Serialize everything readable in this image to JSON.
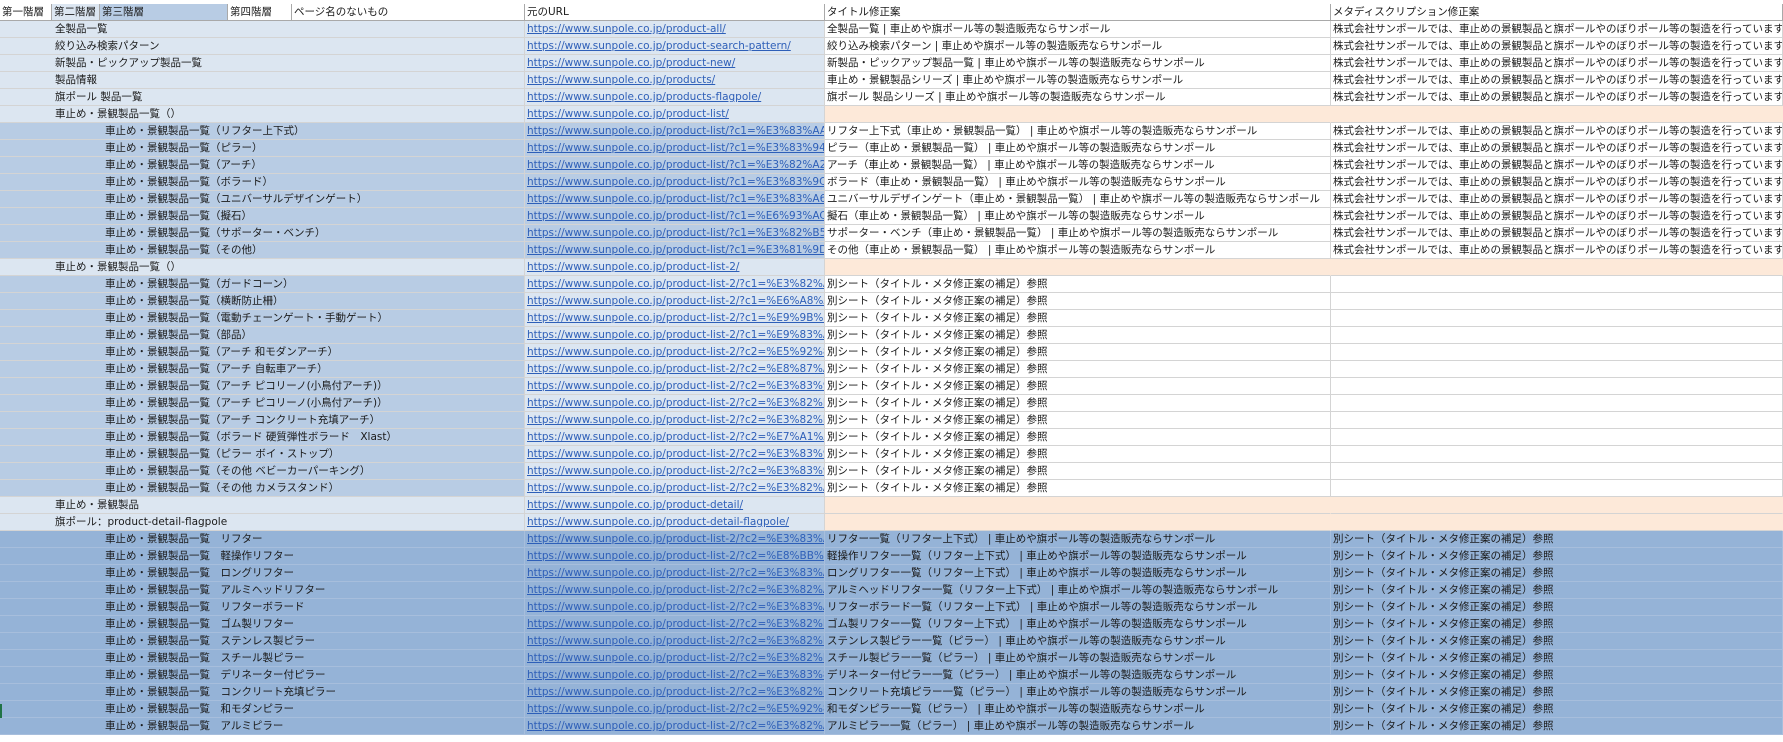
{
  "headers": [
    "第一階層",
    "第二階層",
    "第三階層",
    "第四階層",
    "ページ名のないもの",
    "元のURL",
    "タイトル修正案",
    "メタディスクリプション修正案"
  ],
  "rows": [
    {
      "style": "a",
      "level": 2,
      "name": "全製品一覧",
      "url": "https://www.sunpole.co.jp/product-all/",
      "title": "全製品一覧 | 車止めや旗ポール等の製造販売ならサンポール",
      "meta": "株式会社サンポールでは、車止めの景観製品と旗ポールやのぼりポール等の製造を行っています。"
    },
    {
      "style": "a",
      "level": 2,
      "name": "絞り込み検索パターン",
      "url": "https://www.sunpole.co.jp/product-search-pattern/",
      "title": "絞り込み検索パターン | 車止めや旗ポール等の製造販売ならサンポール",
      "meta": "株式会社サンポールでは、車止めの景観製品と旗ポールやのぼりポール等の製造を行っています。"
    },
    {
      "style": "a",
      "level": 2,
      "name": "新製品・ピックアップ製品一覧",
      "url": "https://www.sunpole.co.jp/product-new/",
      "title": "新製品・ピックアップ製品一覧 | 車止めや旗ポール等の製造販売ならサンポール",
      "meta": "株式会社サンポールでは、車止めの景観製品と旗ポールやのぼりポール等の製造を行っています。"
    },
    {
      "style": "a",
      "level": 2,
      "name": "製品情報",
      "url": "https://www.sunpole.co.jp/products/",
      "title": "車止め・景観製品シリーズ | 車止めや旗ポール等の製造販売ならサンポール",
      "meta": "株式会社サンポールでは、車止めの景観製品と旗ポールやのぼりポール等の製造を行っています。"
    },
    {
      "style": "a",
      "level": 2,
      "name": "旗ポール 製品一覧",
      "url": "https://www.sunpole.co.jp/products-flagpole/",
      "title": "旗ポール 製品シリーズ | 車止めや旗ポール等の製造販売ならサンポール",
      "meta": "株式会社サンポールでは、車止めの景観製品と旗ポールやのぼりポール等の製造を行っています。"
    },
    {
      "style": "b",
      "level": 2,
      "name": "車止め・景観製品一覧（）",
      "url": "https://www.sunpole.co.jp/product-list/",
      "title": "",
      "meta": ""
    },
    {
      "style": "c",
      "level": 3,
      "name": "車止め・景観製品一覧（リフター上下式）",
      "url": "https://www.sunpole.co.jp/product-list/?c1=%E3%83%AA%E3",
      "title": "リフター上下式（車止め・景観製品一覧） | 車止めや旗ポール等の製造販売ならサンポール",
      "meta": "株式会社サンポールでは、車止めの景観製品と旗ポールやのぼりポール等の製造を行っています。"
    },
    {
      "style": "c",
      "level": 3,
      "name": "車止め・景観製品一覧（ピラー）",
      "url": "https://www.sunpole.co.jp/product-list/?c1=%E3%83%94%E3",
      "title": "ピラー（車止め・景観製品一覧） | 車止めや旗ポール等の製造販売ならサンポール",
      "meta": "株式会社サンポールでは、車止めの景観製品と旗ポールやのぼりポール等の製造を行っています。"
    },
    {
      "style": "c",
      "level": 3,
      "name": "車止め・景観製品一覧（アーチ）",
      "url": "https://www.sunpole.co.jp/product-list/?c1=%E3%82%A2%E3",
      "title": "アーチ（車止め・景観製品一覧） | 車止めや旗ポール等の製造販売ならサンポール",
      "meta": "株式会社サンポールでは、車止めの景観製品と旗ポールやのぼりポール等の製造を行っています。"
    },
    {
      "style": "c",
      "level": 3,
      "name": "車止め・景観製品一覧（ボラード）",
      "url": "https://www.sunpole.co.jp/product-list/?c1=%E3%83%9C%E3",
      "title": "ボラード（車止め・景観製品一覧） | 車止めや旗ポール等の製造販売ならサンポール",
      "meta": "株式会社サンポールでは、車止めの景観製品と旗ポールやのぼりポール等の製造を行っています。"
    },
    {
      "style": "c",
      "level": 3,
      "name": "車止め・景観製品一覧（ユニバーサルデザインゲート）",
      "url": "https://www.sunpole.co.jp/product-list/?c1=%E3%83%A6%E3",
      "title": "ユニバーサルデザインゲート（車止め・景観製品一覧） | 車止めや旗ポール等の製造販売ならサンポール",
      "meta": "株式会社サンポールでは、車止めの景観製品と旗ポールやのぼりポール等の製造を行っています。"
    },
    {
      "style": "c",
      "level": 3,
      "name": "車止め・景観製品一覧（擬石）",
      "url": "https://www.sunpole.co.jp/product-list/?c1=%E6%93%AC%E7",
      "title": "擬石（車止め・景観製品一覧） | 車止めや旗ポール等の製造販売ならサンポール",
      "meta": "株式会社サンポールでは、車止めの景観製品と旗ポールやのぼりポール等の製造を行っています。"
    },
    {
      "style": "c",
      "level": 3,
      "name": "車止め・景観製品一覧（サポーター・ベンチ）",
      "url": "https://www.sunpole.co.jp/product-list/?c1=%E3%82%B5%E3",
      "title": "サポーター・ベンチ（車止め・景観製品一覧） | 車止めや旗ポール等の製造販売ならサンポール",
      "meta": "株式会社サンポールでは、車止めの景観製品と旗ポールやのぼりポール等の製造を行っています。"
    },
    {
      "style": "c",
      "level": 3,
      "name": "車止め・景観製品一覧（その他）",
      "url": "https://www.sunpole.co.jp/product-list/?c1=%E3%81%9D%E3",
      "title": "その他（車止め・景観製品一覧） | 車止めや旗ポール等の製造販売ならサンポール",
      "meta": "株式会社サンポールでは、車止めの景観製品と旗ポールやのぼりポール等の製造を行っています。"
    },
    {
      "style": "b",
      "level": 2,
      "name": "車止め・景観製品一覧（）",
      "url": "https://www.sunpole.co.jp/product-list-2/",
      "title": "",
      "meta": ""
    },
    {
      "style": "d",
      "level": 3,
      "name": "車止め・景観製品一覧（ガードコーン）",
      "url": "https://www.sunpole.co.jp/product-list-2/?c1=%E3%82%AC%",
      "title": "別シート（タイトル・メタ修正案の補足）参照",
      "meta": ""
    },
    {
      "style": "d",
      "level": 3,
      "name": "車止め・景観製品一覧（横断防止柵）",
      "url": "https://www.sunpole.co.jp/product-list-2/?c1=%E6%A8%AA%",
      "title": "別シート（タイトル・メタ修正案の補足）参照",
      "meta": ""
    },
    {
      "style": "d",
      "level": 3,
      "name": "車止め・景観製品一覧（電動チェーンゲート・手動ゲート）",
      "url": "https://www.sunpole.co.jp/product-list-2/?c1=%E9%9B%BB%",
      "title": "別シート（タイトル・メタ修正案の補足）参照",
      "meta": ""
    },
    {
      "style": "d",
      "level": 3,
      "name": "車止め・景観製品一覧（部品）",
      "url": "https://www.sunpole.co.jp/product-list-2/?c1=%E9%83%A8%",
      "title": "別シート（タイトル・メタ修正案の補足）参照",
      "meta": ""
    },
    {
      "style": "d",
      "level": 3,
      "name": "車止め・景観製品一覧（アーチ 和モダンアーチ）",
      "url": "https://www.sunpole.co.jp/product-list-2/?c2=%E5%92%8C%",
      "title": "別シート（タイトル・メタ修正案の補足）参照",
      "meta": ""
    },
    {
      "style": "d",
      "level": 3,
      "name": "車止め・景観製品一覧（アーチ 自転車アーチ）",
      "url": "https://www.sunpole.co.jp/product-list-2/?c2=%E8%87%AA%",
      "title": "別シート（タイトル・メタ修正案の補足）参照",
      "meta": ""
    },
    {
      "style": "d",
      "level": 3,
      "name": "車止め・景観製品一覧（アーチ ピコリーノ(小鳥付アーチ)）",
      "url": "https://www.sunpole.co.jp/product-list-2/?c2=%E3%83%94%",
      "title": "別シート（タイトル・メタ修正案の補足）参照",
      "meta": ""
    },
    {
      "style": "d",
      "level": 3,
      "name": "車止め・景観製品一覧（アーチ ピコリーノ(小鳥付アーチ)）",
      "url": "https://www.sunpole.co.jp/product-list-2/?c2=%E3%82%B3%",
      "title": "別シート（タイトル・メタ修正案の補足）参照",
      "meta": ""
    },
    {
      "style": "d",
      "level": 3,
      "name": "車止め・景観製品一覧（アーチ コンクリート充填アーチ）",
      "url": "https://www.sunpole.co.jp/product-list-2/?c2=%E3%82%B3%",
      "title": "別シート（タイトル・メタ修正案の補足）参照",
      "meta": ""
    },
    {
      "style": "d",
      "level": 3,
      "name": "車止め・景観製品一覧（ボラード 硬質弾性ボラード　Xlast）",
      "url": "https://www.sunpole.co.jp/product-list-2/?c2=%E7%A1%AC%",
      "title": "別シート（タイトル・メタ修正案の補足）参照",
      "meta": ""
    },
    {
      "style": "d",
      "level": 3,
      "name": "車止め・景観製品一覧（ピラー ボイ・ストップ）",
      "url": "https://www.sunpole.co.jp/product-list-2/?c2=%E3%83%9D%",
      "title": "別シート（タイトル・メタ修正案の補足）参照",
      "meta": ""
    },
    {
      "style": "d",
      "level": 3,
      "name": "車止め・景観製品一覧（その他 ベビーカーパーキング）",
      "url": "https://www.sunpole.co.jp/product-list-2/?c2=%E3%83%99%",
      "title": "別シート（タイトル・メタ修正案の補足）参照",
      "meta": ""
    },
    {
      "style": "d",
      "level": 3,
      "name": "車止め・景観製品一覧（その他 カメラスタンド）",
      "url": "https://www.sunpole.co.jp/product-list-2/?c2=%E3%82%AB%",
      "title": "別シート（タイトル・メタ修正案の補足）参照",
      "meta": ""
    },
    {
      "style": "b",
      "level": 2,
      "name": "車止め・景観製品",
      "url": "https://www.sunpole.co.jp/product-detail/",
      "title": "",
      "meta": ""
    },
    {
      "style": "b",
      "level": 2,
      "name": "旗ポール：product-detail-flagpole",
      "url": "https://www.sunpole.co.jp/product-detail-flagpole/",
      "title": "",
      "meta": ""
    },
    {
      "style": "e",
      "level": 3,
      "name": "車止め・景観製品一覧　リフター",
      "url": "https://www.sunpole.co.jp/product-list-2/?c2=%E3%83%AA%",
      "title": "リフター一覧（リフター上下式） | 車止めや旗ポール等の製造販売ならサンポール",
      "meta": "別シート（タイトル・メタ修正案の補足）参照"
    },
    {
      "style": "e",
      "level": 3,
      "name": "車止め・景観製品一覧　軽操作リフター",
      "url": "https://www.sunpole.co.jp/product-list-2/?c2=%E8%BB%BD%",
      "title": "軽操作リフター一覧（リフター上下式） | 車止めや旗ポール等の製造販売ならサンポール",
      "meta": "別シート（タイトル・メタ修正案の補足）参照"
    },
    {
      "style": "e",
      "level": 3,
      "name": "車止め・景観製品一覧　ロングリフター",
      "url": "https://www.sunpole.co.jp/product-list-2/?c2=%E3%83%AD%",
      "title": "ロングリフター一覧（リフター上下式） | 車止めや旗ポール等の製造販売ならサンポール",
      "meta": "別シート（タイトル・メタ修正案の補足）参照"
    },
    {
      "style": "e",
      "level": 3,
      "name": "車止め・景観製品一覧　アルミヘッドリフター",
      "url": "https://www.sunpole.co.jp/product-list-2/?c2=%E3%82%A2%",
      "title": "アルミヘッドリフター一覧（リフター上下式） | 車止めや旗ポール等の製造販売ならサンポール",
      "meta": "別シート（タイトル・メタ修正案の補足）参照"
    },
    {
      "style": "e",
      "level": 3,
      "name": "車止め・景観製品一覧　リフターボラード",
      "url": "https://www.sunpole.co.jp/product-list-2/?c2=%E3%83%AA%",
      "title": "リフターボラード一覧（リフター上下式） | 車止めや旗ポール等の製造販売ならサンポール",
      "meta": "別シート（タイトル・メタ修正案の補足）参照"
    },
    {
      "style": "e",
      "level": 3,
      "name": "車止め・景観製品一覧　ゴム製リフター",
      "url": "https://www.sunpole.co.jp/product-list-2/?c2=%E3%82%B4%",
      "title": "ゴム製リフター一覧（リフター上下式） | 車止めや旗ポール等の製造販売ならサンポール",
      "meta": "別シート（タイトル・メタ修正案の補足）参照"
    },
    {
      "style": "e",
      "level": 3,
      "name": "車止め・景観製品一覧　ステンレス製ピラー",
      "url": "https://www.sunpole.co.jp/product-list-2/?c2=%E3%82%B9%",
      "title": "ステンレス製ピラー一覧（ピラー） | 車止めや旗ポール等の製造販売ならサンポール",
      "meta": "別シート（タイトル・メタ修正案の補足）参照"
    },
    {
      "style": "e",
      "level": 3,
      "name": "車止め・景観製品一覧　スチール製ピラー",
      "url": "https://www.sunpole.co.jp/product-list-2/?c2=%E3%82%B9%",
      "title": "スチール製ピラー一覧（ピラー） | 車止めや旗ポール等の製造販売ならサンポール",
      "meta": "別シート（タイトル・メタ修正案の補足）参照"
    },
    {
      "style": "e",
      "level": 3,
      "name": "車止め・景観製品一覧　デリネーター付ピラー",
      "url": "https://www.sunpole.co.jp/product-list-2/?c2=%E3%83%87%",
      "title": "デリネーター付ピラー一覧（ピラー） | 車止めや旗ポール等の製造販売ならサンポール",
      "meta": "別シート（タイトル・メタ修正案の補足）参照"
    },
    {
      "style": "e",
      "level": 3,
      "name": "車止め・景観製品一覧　コンクリート充填ピラー",
      "url": "https://www.sunpole.co.jp/product-list-2/?c2=%E3%82%B3%",
      "title": "コンクリート充填ピラー一覧（ピラー） | 車止めや旗ポール等の製造販売ならサンポール",
      "meta": "別シート（タイトル・メタ修正案の補足）参照"
    },
    {
      "style": "e",
      "level": 3,
      "name": "車止め・景観製品一覧　和モダンピラー",
      "url": "https://www.sunpole.co.jp/product-list-2/?c2=%E5%92%8C%",
      "title": "和モダンピラー一覧（ピラー） | 車止めや旗ポール等の製造販売ならサンポール",
      "meta": "別シート（タイトル・メタ修正案の補足）参照"
    },
    {
      "style": "e",
      "level": 3,
      "name": "車止め・景観製品一覧　アルミピラー",
      "url": "https://www.sunpole.co.jp/product-list-2/?c2=%E3%82%A2%",
      "title": "アルミピラー一覧（ピラー） | 車止めや旗ポール等の製造販売ならサンポール",
      "meta": "別シート（タイトル・メタ修正案の補足）参照"
    }
  ]
}
